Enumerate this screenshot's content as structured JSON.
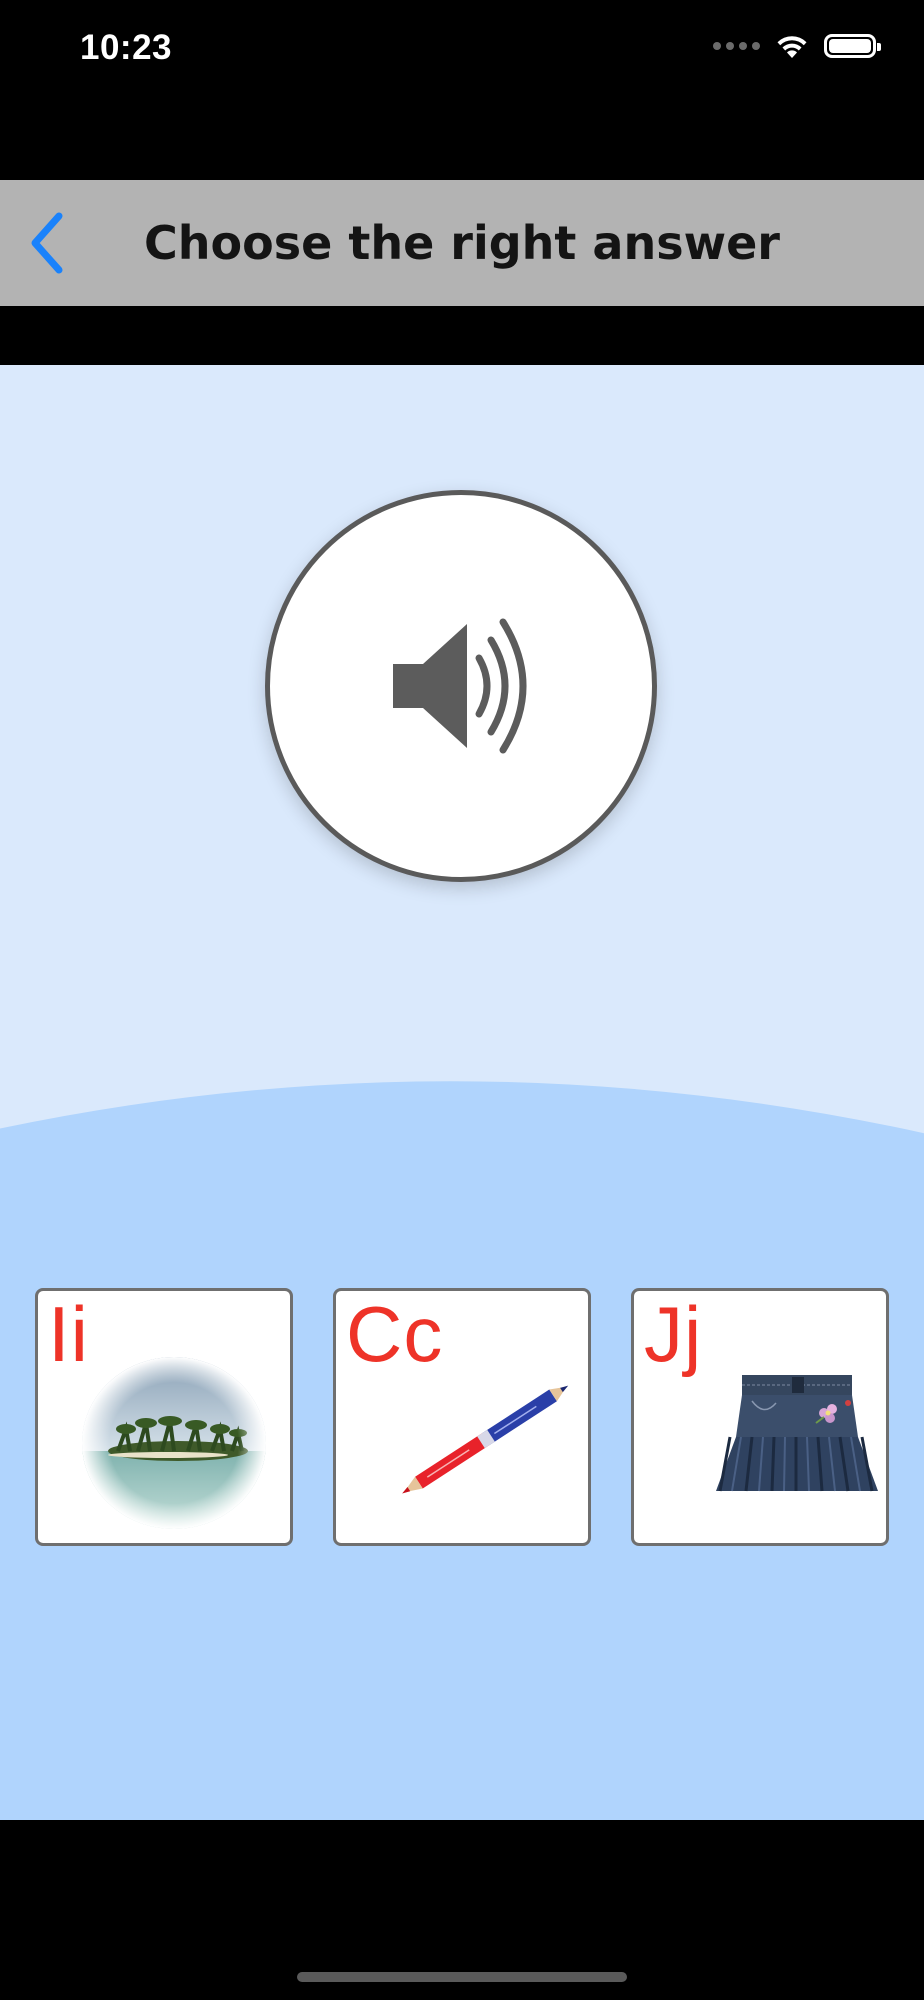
{
  "status_bar": {
    "time": "10:23",
    "icons": [
      "signal-dots-icon",
      "wifi-icon",
      "battery-icon"
    ]
  },
  "nav_bar": {
    "back_icon": "chevron-left-icon",
    "title": "Choose the right answer",
    "accent_color": "#1a82fb"
  },
  "audio_prompt": {
    "icon": "speaker-icon"
  },
  "choices": [
    {
      "letter": "Ii",
      "image": "island-image"
    },
    {
      "letter": "Cc",
      "image": "pencil-image"
    },
    {
      "letter": "Jj",
      "image": "skirt-image"
    }
  ],
  "colors": {
    "background_top": "#dae9fc",
    "background_bottom": "#b0d4fd",
    "nav_background": "#b3b3b3",
    "letter_color": "#ee3328"
  }
}
